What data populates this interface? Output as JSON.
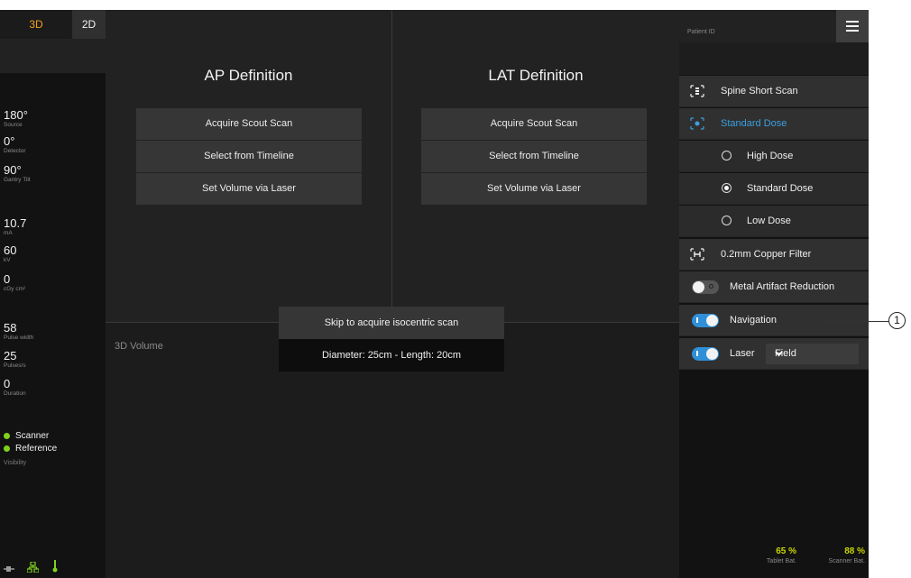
{
  "mode_tabs": {
    "tab_3d": "3D",
    "tab_2d": "2D"
  },
  "parameters": [
    {
      "value": "180°",
      "label": "Source"
    },
    {
      "value": "0°",
      "label": "Detector"
    },
    {
      "value": "90°",
      "label": "Gantry Tilt"
    },
    {
      "value": "10.7",
      "label": "mA"
    },
    {
      "value": "60",
      "label": "kV"
    },
    {
      "value": "0",
      "label": "cGy cm²"
    },
    {
      "value": "58",
      "label": "Pulse width"
    },
    {
      "value": "25",
      "label": "Pulses/s"
    },
    {
      "value": "0",
      "label": "Duration"
    }
  ],
  "status": {
    "scanner": "Scanner",
    "reference": "Reference",
    "visibility": "Visibility",
    "dot_color": "#7fd21e"
  },
  "ap": {
    "title": "AP Definition",
    "options": [
      "Acquire Scout Scan",
      "Select from Timeline",
      "Set Volume via Laser"
    ]
  },
  "lat": {
    "title": "LAT Definition",
    "options": [
      "Acquire Scout Scan",
      "Select from Timeline",
      "Set Volume via Laser"
    ]
  },
  "volume": {
    "label": "3D Volume"
  },
  "popup": {
    "skip": "Skip to acquire isocentric scan",
    "dimensions": "Diameter: 25cm - Length: 20cm"
  },
  "right": {
    "patient_label": "Patient ID",
    "protocol": "Spine Short Scan",
    "dose_selected": "Standard Dose",
    "dose_options": [
      {
        "label": "High Dose",
        "selected": false
      },
      {
        "label": "Standard Dose",
        "selected": true
      },
      {
        "label": "Low Dose",
        "selected": false
      }
    ],
    "filter": "0.2mm Copper Filter",
    "metal_artifact": {
      "label": "Metal Artifact Reduction",
      "on": false
    },
    "navigation": {
      "label": "Navigation",
      "on": true
    },
    "laser": {
      "label": "Laser",
      "on": true,
      "mode": "Field"
    },
    "tablet_battery": {
      "percent": "65 %",
      "label": "Tablet Bat."
    },
    "scanner_battery": {
      "percent": "88 %",
      "label": "Scanner Bat."
    }
  },
  "callout": "1",
  "colors": {
    "accent_orange": "#f0a020",
    "accent_blue": "#3aa0e0",
    "toggle_on": "#2f8fd8",
    "battery": "#c8d400"
  }
}
